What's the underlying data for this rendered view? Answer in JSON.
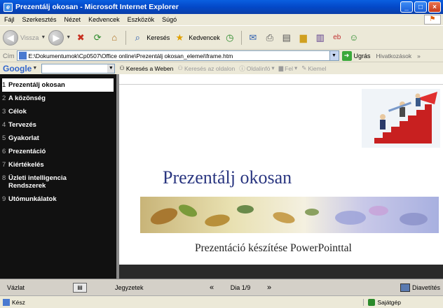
{
  "window": {
    "title": "Prezentálj okosan - Microsoft Internet Explorer",
    "app_icon": "e",
    "buttons": [
      "_",
      "□",
      "×"
    ]
  },
  "menu": [
    "Fájl",
    "Szerkesztés",
    "Nézet",
    "Kedvencek",
    "Eszközök",
    "Súgó"
  ],
  "toolbar": {
    "back": "Vissza",
    "search": "Keresés",
    "favorites": "Kedvencek"
  },
  "address": {
    "label": "Cím",
    "value": "E:\\Dokumentumok\\Cp0507\\Office online\\Prezentálj okosan_elemei\\frame.htm",
    "go": "Ugrás",
    "links": "Hivatkozások"
  },
  "google": {
    "logo": "Google",
    "search_web": "Keresés a Weben",
    "search_site": "Keresés az oldalon",
    "pageinfo": "Oldalinfó",
    "up": "Fel",
    "highlight": "Kiemel"
  },
  "nav": {
    "items": [
      {
        "num": "1",
        "label": "Prezentálj okosan",
        "active": true
      },
      {
        "num": "2",
        "label": "A közönség"
      },
      {
        "num": "3",
        "label": "Célok"
      },
      {
        "num": "4",
        "label": "Tervezés"
      },
      {
        "num": "5",
        "label": "Gyakorlat"
      },
      {
        "num": "6",
        "label": "Prezentáció"
      },
      {
        "num": "7",
        "label": "Kiértékelés"
      },
      {
        "num": "8",
        "label": "Üzleti intelligencia Rendszerek"
      },
      {
        "num": "9",
        "label": "Utómunkálatok"
      }
    ]
  },
  "slide": {
    "title": "Prezentálj okosan",
    "subtitle": "Prezentáció készítése PowerPointtal"
  },
  "bottom": {
    "outline": "Vázlat",
    "notes": "Jegyzetek",
    "prev": "«",
    "slide_num": "Dia 1/9",
    "next": "»",
    "show": "Diavetítés"
  },
  "status": {
    "text": "Kész",
    "zone": "Sajátgép"
  },
  "colors": {
    "title_bar": "#0348c8",
    "nav_bg": "#111111",
    "slide_title": "#2a3680"
  }
}
